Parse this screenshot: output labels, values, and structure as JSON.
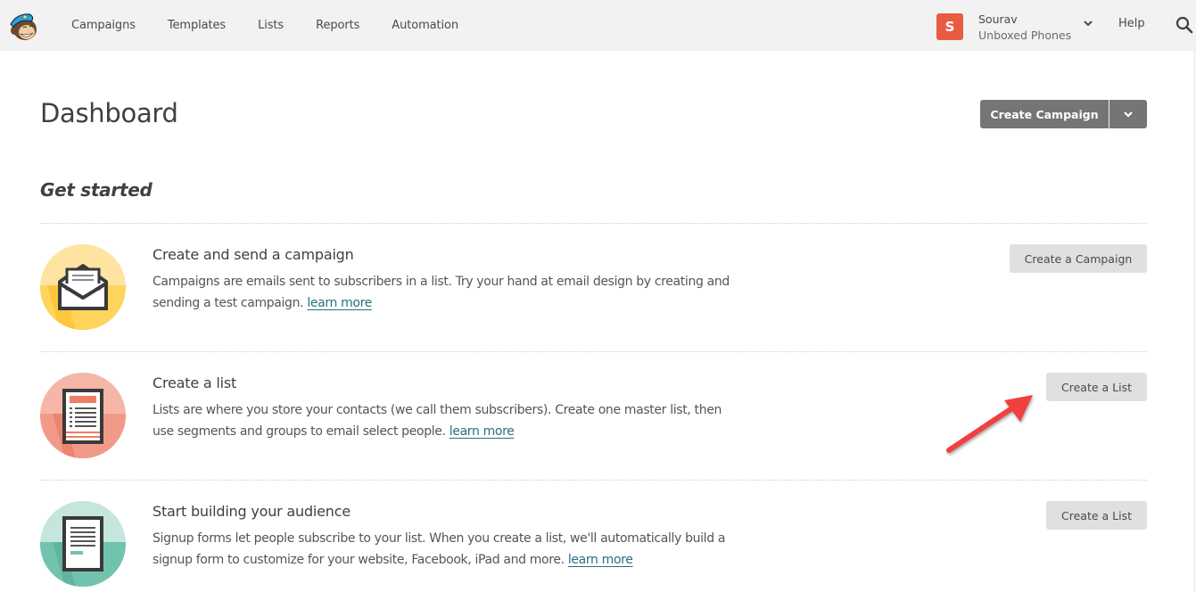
{
  "topbar": {
    "logo_icon": "mailchimp-freddie-logo",
    "nav": [
      {
        "label": "Campaigns"
      },
      {
        "label": "Templates"
      },
      {
        "label": "Lists"
      },
      {
        "label": "Reports"
      },
      {
        "label": "Automation"
      }
    ],
    "account": {
      "avatar_letter": "S",
      "avatar_color": "#e85c41",
      "name": "Sourav",
      "organization": "Unboxed Phones"
    },
    "help_label": "Help",
    "search_icon": "search-icon"
  },
  "page": {
    "title": "Dashboard",
    "create_campaign_label": "Create Campaign",
    "section_title": "Get started"
  },
  "cards": [
    {
      "title": "Create and send a campaign",
      "description": "Campaigns are emails sent to subscribers in a list. Try your hand at email design by creating and sending a test campaign.",
      "link_label": "learn more",
      "button_label": "Create a Campaign",
      "icon": "envelope-icon",
      "accent_color": "#ffd560"
    },
    {
      "title": "Create a list",
      "description": "Lists are where you store your contacts (we call them subscribers). Create one master list, then use segments and groups to email select people.",
      "link_label": "learn more",
      "button_label": "Create a List",
      "icon": "list-document-icon",
      "accent_color": "#f29a89"
    },
    {
      "title": "Start building your audience",
      "description": "Signup forms let people subscribe to your list. When you create a list, we'll automatically build a signup form to customize for your website, Facebook, iPad and more.",
      "link_label": "learn more",
      "button_label": "Create a List",
      "icon": "signup-form-icon",
      "accent_color": "#72c3ae"
    }
  ],
  "annotation": {
    "arrow_color": "#f0403f",
    "points_to": "Create a List"
  }
}
